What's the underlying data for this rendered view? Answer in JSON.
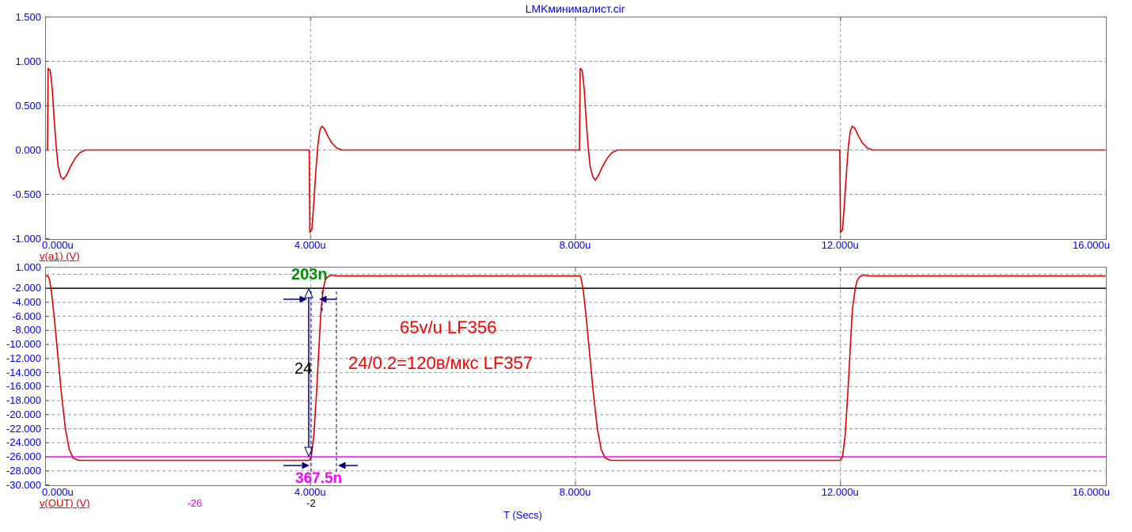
{
  "title": "LMKминималист.cir",
  "x_axis_title": "T (Secs)",
  "colors": {
    "trace": "#e00000",
    "axis_text": "#0000ff",
    "grid": "#9a9a9a",
    "border": "#707070",
    "annotation_arrows": "#000080",
    "cursor_black": "#000000",
    "cursor_magenta": "#ff00ff"
  },
  "annotations": {
    "rise_time_fast": {
      "text": "203n",
      "color": "#009000"
    },
    "delta_v": {
      "text": "24",
      "color": "#000000"
    },
    "rise_time_slow": {
      "text": "367.5n",
      "color": "#ff00ff"
    },
    "note_lf356": {
      "text": "65v/u LF356",
      "color": "#ff0000"
    },
    "note_lf357": {
      "text": "24/0.2=120в/мкс LF357",
      "color": "#ff0000"
    }
  },
  "chart_data": [
    {
      "type": "line",
      "name": "v(a1)",
      "legend": "v(a1) (V)",
      "color": "#e00000",
      "xlabel": "T (Secs)",
      "ylabel": "v(a1) (V)",
      "xlim": [
        0,
        16
      ],
      "ylim": [
        -1.0,
        1.5
      ],
      "x_ticks": [
        {
          "label": "0.000u",
          "value": 0
        },
        {
          "label": "4.000u",
          "value": 4
        },
        {
          "label": "8.000u",
          "value": 8
        },
        {
          "label": "12.000u",
          "value": 12
        },
        {
          "label": "16.000u",
          "value": 16
        }
      ],
      "y_ticks": [
        {
          "label": "1.500",
          "value": 1.5
        },
        {
          "label": "1.000",
          "value": 1.0
        },
        {
          "label": "0.500",
          "value": 0.5
        },
        {
          "label": "0.000",
          "value": 0.0
        },
        {
          "label": "-0.500",
          "value": -0.5
        },
        {
          "label": "-1.000",
          "value": -1.0
        }
      ],
      "y_grid": [
        1.0,
        0.5,
        0.0,
        -0.5
      ],
      "x_grid": [
        4,
        8,
        12
      ],
      "points": [
        [
          0,
          0
        ],
        [
          0.03,
          0
        ],
        [
          0.04,
          0.92
        ],
        [
          0.07,
          0.9
        ],
        [
          0.1,
          0.7
        ],
        [
          0.13,
          0.35
        ],
        [
          0.16,
          0.05
        ],
        [
          0.19,
          -0.18
        ],
        [
          0.23,
          -0.3
        ],
        [
          0.27,
          -0.33
        ],
        [
          0.32,
          -0.28
        ],
        [
          0.38,
          -0.18
        ],
        [
          0.45,
          -0.09
        ],
        [
          0.52,
          -0.03
        ],
        [
          0.6,
          0
        ],
        [
          3.98,
          0
        ],
        [
          3.99,
          -0.93
        ],
        [
          4.02,
          -0.9
        ],
        [
          4.05,
          -0.6
        ],
        [
          4.08,
          -0.25
        ],
        [
          4.11,
          0.05
        ],
        [
          4.14,
          0.22
        ],
        [
          4.17,
          0.27
        ],
        [
          4.21,
          0.24
        ],
        [
          4.26,
          0.16
        ],
        [
          4.32,
          0.08
        ],
        [
          4.4,
          0.02
        ],
        [
          4.48,
          0
        ],
        [
          8.06,
          0
        ],
        [
          8.07,
          0.92
        ],
        [
          8.1,
          0.9
        ],
        [
          8.13,
          0.7
        ],
        [
          8.16,
          0.35
        ],
        [
          8.19,
          0.05
        ],
        [
          8.22,
          -0.18
        ],
        [
          8.26,
          -0.3
        ],
        [
          8.3,
          -0.34
        ],
        [
          8.35,
          -0.28
        ],
        [
          8.41,
          -0.18
        ],
        [
          8.48,
          -0.09
        ],
        [
          8.55,
          -0.03
        ],
        [
          8.63,
          0
        ],
        [
          11.99,
          0
        ],
        [
          12.0,
          -0.93
        ],
        [
          12.03,
          -0.9
        ],
        [
          12.06,
          -0.6
        ],
        [
          12.09,
          -0.25
        ],
        [
          12.12,
          0.05
        ],
        [
          12.15,
          0.22
        ],
        [
          12.18,
          0.27
        ],
        [
          12.22,
          0.24
        ],
        [
          12.27,
          0.16
        ],
        [
          12.33,
          0.08
        ],
        [
          12.41,
          0.02
        ],
        [
          12.49,
          0
        ],
        [
          16,
          0
        ]
      ]
    },
    {
      "type": "line",
      "name": "v(OUT)",
      "legend": "v(OUT) (V)",
      "color": "#e00000",
      "xlabel": "T (Secs)",
      "ylabel": "v(OUT) (V)",
      "xlim": [
        0,
        16
      ],
      "ylim": [
        -30.0,
        1.0
      ],
      "x_ticks": [
        {
          "label": "0.000u",
          "value": 0
        },
        {
          "label": "4.000u",
          "value": 4
        },
        {
          "label": "8.000u",
          "value": 8
        },
        {
          "label": "12.000u",
          "value": 12
        },
        {
          "label": "16.000u",
          "value": 16
        }
      ],
      "y_ticks": [
        {
          "label": "1.000",
          "value": 1.0
        },
        {
          "label": "-2.000",
          "value": -2.0
        },
        {
          "label": "-4.000",
          "value": -4.0
        },
        {
          "label": "-6.000",
          "value": -6.0
        },
        {
          "label": "-8.000",
          "value": -8.0
        },
        {
          "label": "-10.000",
          "value": -10.0
        },
        {
          "label": "-12.000",
          "value": -12.0
        },
        {
          "label": "-14.000",
          "value": -14.0
        },
        {
          "label": "-16.000",
          "value": -16.0
        },
        {
          "label": "-18.000",
          "value": -18.0
        },
        {
          "label": "-20.000",
          "value": -20.0
        },
        {
          "label": "-22.000",
          "value": -22.0
        },
        {
          "label": "-24.000",
          "value": -24.0
        },
        {
          "label": "-26.000",
          "value": -26.0
        },
        {
          "label": "-28.000",
          "value": -28.0
        },
        {
          "label": "-30.000",
          "value": -30.0
        }
      ],
      "y_grid": [
        0,
        -4,
        -6,
        -8,
        -10,
        -12,
        -14,
        -16,
        -18,
        -20,
        -22,
        -24,
        -28
      ],
      "x_grid": [
        4,
        8,
        12
      ],
      "cursor_lines": [
        {
          "label": "-26",
          "value": -26,
          "color": "#ff00ff"
        },
        {
          "label": "-2",
          "value": -2,
          "color": "#000000"
        }
      ],
      "points": [
        [
          0,
          -0.25
        ],
        [
          0.04,
          -0.25
        ],
        [
          0.06,
          -0.8
        ],
        [
          0.09,
          -2.5
        ],
        [
          0.13,
          -6
        ],
        [
          0.18,
          -11
        ],
        [
          0.24,
          -17
        ],
        [
          0.3,
          -22
        ],
        [
          0.36,
          -25
        ],
        [
          0.42,
          -26.2
        ],
        [
          0.5,
          -26.5
        ],
        [
          3.98,
          -26.5
        ],
        [
          4.01,
          -26.0
        ],
        [
          4.05,
          -23
        ],
        [
          4.09,
          -17
        ],
        [
          4.13,
          -10
        ],
        [
          4.16,
          -5
        ],
        [
          4.19,
          -2.2
        ],
        [
          4.22,
          -0.9
        ],
        [
          4.26,
          -0.35
        ],
        [
          4.32,
          -0.12
        ],
        [
          4.4,
          -0.25
        ],
        [
          8.07,
          -0.25
        ],
        [
          8.09,
          -0.8
        ],
        [
          8.12,
          -2.5
        ],
        [
          8.16,
          -6
        ],
        [
          8.21,
          -11
        ],
        [
          8.27,
          -17
        ],
        [
          8.33,
          -22
        ],
        [
          8.39,
          -25
        ],
        [
          8.45,
          -26.2
        ],
        [
          8.53,
          -26.5
        ],
        [
          12.0,
          -26.5
        ],
        [
          12.03,
          -26.0
        ],
        [
          12.07,
          -23
        ],
        [
          12.11,
          -17
        ],
        [
          12.15,
          -10
        ],
        [
          12.18,
          -5
        ],
        [
          12.22,
          -2.2
        ],
        [
          12.25,
          -0.9
        ],
        [
          12.29,
          -0.35
        ],
        [
          12.35,
          -0.1
        ],
        [
          12.43,
          -0.25
        ],
        [
          16,
          -0.25
        ]
      ]
    }
  ]
}
